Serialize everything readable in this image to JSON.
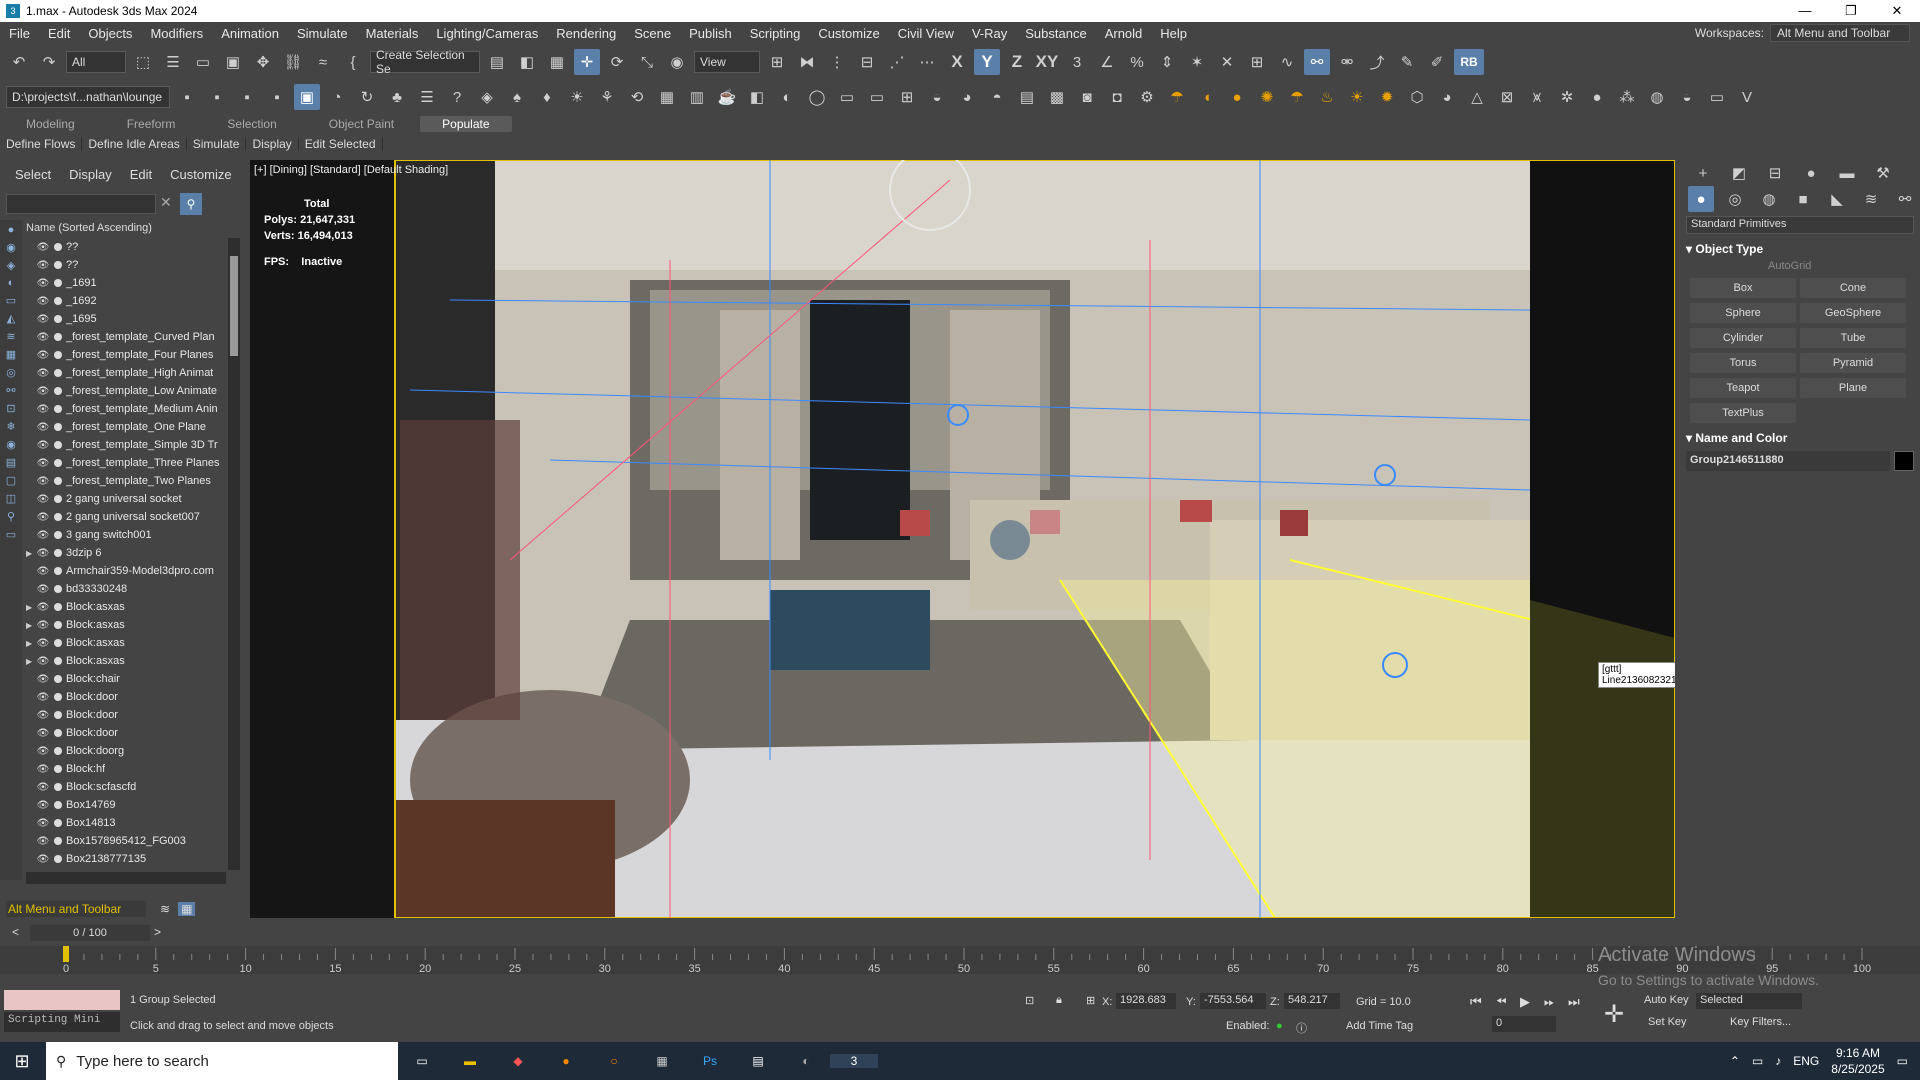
{
  "window": {
    "title": "1.max - Autodesk 3ds Max 2024",
    "app_icon": "3"
  },
  "menu": [
    "File",
    "Edit",
    "Objects",
    "Modifiers",
    "Animation",
    "Simulate",
    "Materials",
    "Lighting/Cameras",
    "Rendering",
    "Scene",
    "Publish",
    "Scripting",
    "Customize",
    "Civil View",
    "V-Ray",
    "Substance",
    "Arnold",
    "Help"
  ],
  "workspace": {
    "label": "Workspaces:",
    "value": "Alt Menu and Toolbar"
  },
  "toolbar1": {
    "filter": "All",
    "selection_set": "Create Selection Se",
    "ref_coord": "View",
    "axis_x": "X",
    "axis_y": "Y",
    "axis_z": "Z",
    "axis_xy": "XY",
    "rb": "RB"
  },
  "toolbar2": {
    "project_path": "D:\\projects\\f...nathan\\lounge"
  },
  "ribbon_tabs": [
    "Modeling",
    "Freeform",
    "Selection",
    "Object Paint",
    "Populate"
  ],
  "subribbon": [
    "Define Flows",
    "Define Idle Areas",
    "Simulate",
    "Display",
    "Edit Selected"
  ],
  "explorer": {
    "menu": [
      "Select",
      "Display",
      "Edit",
      "Customize"
    ],
    "header": "Name (Sorted Ascending)",
    "rows": [
      {
        "name": "??",
        "arrow": ""
      },
      {
        "name": "??",
        "arrow": ""
      },
      {
        "name": "_1691",
        "arrow": ""
      },
      {
        "name": "_1692",
        "arrow": ""
      },
      {
        "name": "_1695",
        "arrow": ""
      },
      {
        "name": "_forest_template_Curved Plan",
        "arrow": ""
      },
      {
        "name": "_forest_template_Four Planes",
        "arrow": ""
      },
      {
        "name": "_forest_template_High Animat",
        "arrow": ""
      },
      {
        "name": "_forest_template_Low Animate",
        "arrow": ""
      },
      {
        "name": "_forest_template_Medium Anin",
        "arrow": ""
      },
      {
        "name": "_forest_template_One Plane",
        "arrow": ""
      },
      {
        "name": "_forest_template_Simple 3D Tr",
        "arrow": ""
      },
      {
        "name": "_forest_template_Three Planes",
        "arrow": ""
      },
      {
        "name": "_forest_template_Two Planes",
        "arrow": ""
      },
      {
        "name": "2 gang universal socket",
        "arrow": ""
      },
      {
        "name": "2 gang universal socket007",
        "arrow": ""
      },
      {
        "name": "3 gang switch001",
        "arrow": ""
      },
      {
        "name": "3dzip 6",
        "arrow": "▶"
      },
      {
        "name": "Armchair359-Model3dpro.com",
        "arrow": ""
      },
      {
        "name": "bd33330248",
        "arrow": ""
      },
      {
        "name": "Block:asxas",
        "arrow": "▶"
      },
      {
        "name": "Block:asxas",
        "arrow": "▶"
      },
      {
        "name": "Block:asxas",
        "arrow": "▶"
      },
      {
        "name": "Block:asxas",
        "arrow": "▶"
      },
      {
        "name": "Block:chair",
        "arrow": ""
      },
      {
        "name": "Block:door",
        "arrow": ""
      },
      {
        "name": "Block:door",
        "arrow": ""
      },
      {
        "name": "Block:door",
        "arrow": ""
      },
      {
        "name": "Block:doorg",
        "arrow": ""
      },
      {
        "name": "Block:hf",
        "arrow": ""
      },
      {
        "name": "Block:scfascfd",
        "arrow": ""
      },
      {
        "name": "Box14769",
        "arrow": ""
      },
      {
        "name": "Box14813",
        "arrow": ""
      },
      {
        "name": "Box1578965412_FG003",
        "arrow": ""
      },
      {
        "name": "Box2138777135",
        "arrow": ""
      }
    ],
    "bottom": "Alt Menu and Toolbar"
  },
  "viewport": {
    "label": "[+] [Dining] [Standard] [Default Shading]",
    "total": "Total",
    "polys_label": "Polys:",
    "polys": "21,647,331",
    "verts_label": "Verts:",
    "verts": "16,494,013",
    "fps_label": "FPS:",
    "fps": "Inactive",
    "tooltip": "[gttt] Line2136082321"
  },
  "command_panel": {
    "category": "Standard Primitives",
    "object_type": "Object Type",
    "autogrid": "AutoGrid",
    "buttons": [
      "Box",
      "Cone",
      "Sphere",
      "GeoSphere",
      "Cylinder",
      "Tube",
      "Torus",
      "Pyramid",
      "Teapot",
      "Plane",
      "TextPlus"
    ],
    "name_and_color": "Name and Color",
    "name": "Group2146511880"
  },
  "timeline": {
    "frame": "0 / 100",
    "ticks": [
      "0",
      "5",
      "10",
      "15",
      "20",
      "25",
      "30",
      "35",
      "40",
      "45",
      "50",
      "55",
      "60",
      "65",
      "70",
      "75",
      "80",
      "85",
      "90",
      "95",
      "100"
    ]
  },
  "status": {
    "selected": "1 Group Selected",
    "hint": "Click and drag to select and move objects",
    "script_label": "Scripting Mini",
    "x_label": "X:",
    "x": "1928.683",
    "y_label": "Y:",
    "y": "-7553.564",
    "z_label": "Z:",
    "z": "548.217",
    "grid": "Grid = 10.0",
    "enabled": "Enabled:",
    "add_time_tag": "Add Time Tag",
    "auto_key": "Auto Key",
    "set_key": "Set Key",
    "selected_drop": "Selected",
    "key_filters": "Key Filters...",
    "frame_field": "0"
  },
  "watermark": {
    "line1": "Activate Windows",
    "line2": "Go to Settings to activate Windows."
  },
  "taskbar": {
    "search_placeholder": "Type here to search",
    "lang": "ENG",
    "time": "9:16 AM",
    "date": "8/25/2025"
  }
}
